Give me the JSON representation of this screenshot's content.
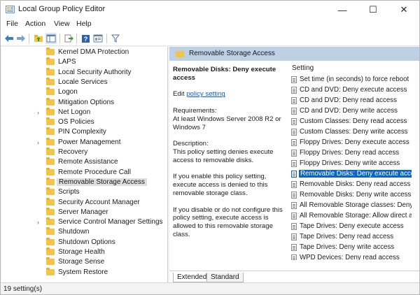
{
  "window": {
    "title": "Local Group Policy Editor",
    "minimize": "—",
    "maximize": "☐",
    "close": "✕"
  },
  "menu": [
    "File",
    "Action",
    "View",
    "Help"
  ],
  "toolbar": {
    "icons": [
      "back-arrow-icon",
      "forward-arrow-icon",
      "up-folder-icon",
      "show-hide-tree-icon",
      "export-list-icon",
      "help-icon",
      "properties-icon",
      "filter-icon"
    ]
  },
  "tree": {
    "items": [
      {
        "label": "Kernel DMA Protection",
        "expandable": false,
        "selected": false
      },
      {
        "label": "LAPS",
        "expandable": false,
        "selected": false
      },
      {
        "label": "Local Security Authority",
        "expandable": false,
        "selected": false
      },
      {
        "label": "Locale Services",
        "expandable": false,
        "selected": false
      },
      {
        "label": "Logon",
        "expandable": false,
        "selected": false
      },
      {
        "label": "Mitigation Options",
        "expandable": false,
        "selected": false
      },
      {
        "label": "Net Logon",
        "expandable": true,
        "selected": false
      },
      {
        "label": "OS Policies",
        "expandable": false,
        "selected": false
      },
      {
        "label": "PIN Complexity",
        "expandable": false,
        "selected": false
      },
      {
        "label": "Power Management",
        "expandable": true,
        "selected": false
      },
      {
        "label": "Recovery",
        "expandable": false,
        "selected": false
      },
      {
        "label": "Remote Assistance",
        "expandable": false,
        "selected": false
      },
      {
        "label": "Remote Procedure Call",
        "expandable": false,
        "selected": false
      },
      {
        "label": "Removable Storage Access",
        "expandable": false,
        "selected": true
      },
      {
        "label": "Scripts",
        "expandable": false,
        "selected": false
      },
      {
        "label": "Security Account Manager",
        "expandable": false,
        "selected": false
      },
      {
        "label": "Server Manager",
        "expandable": false,
        "selected": false
      },
      {
        "label": "Service Control Manager Settings",
        "expandable": true,
        "selected": false
      },
      {
        "label": "Shutdown",
        "expandable": false,
        "selected": false
      },
      {
        "label": "Shutdown Options",
        "expandable": false,
        "selected": false
      },
      {
        "label": "Storage Health",
        "expandable": false,
        "selected": false
      },
      {
        "label": "Storage Sense",
        "expandable": false,
        "selected": false
      },
      {
        "label": "System Restore",
        "expandable": false,
        "selected": false
      }
    ]
  },
  "details": {
    "header": "Removable Storage Access",
    "policy_title": "Removable Disks: Deny execute access",
    "edit_prefix": "Edit ",
    "edit_link": "policy setting",
    "requirements_label": "Requirements:",
    "requirements_text": "At least Windows Server 2008 R2 or Windows 7",
    "description_label": "Description:",
    "description_text": "This policy setting denies execute access to removable disks.",
    "enable_text": "If you enable this policy setting, execute access is denied to this removable storage class.",
    "disable_text": "If you disable or do not configure this policy setting, execute access is allowed to this removable storage class."
  },
  "settings": {
    "column_header": "Setting",
    "rows": [
      {
        "label": "Set time (in seconds) to force reboot",
        "selected": false
      },
      {
        "label": "CD and DVD: Deny execute access",
        "selected": false
      },
      {
        "label": "CD and DVD: Deny read access",
        "selected": false
      },
      {
        "label": "CD and DVD: Deny write access",
        "selected": false
      },
      {
        "label": "Custom Classes: Deny read access",
        "selected": false
      },
      {
        "label": "Custom Classes: Deny write access",
        "selected": false
      },
      {
        "label": "Floppy Drives: Deny execute access",
        "selected": false
      },
      {
        "label": "Floppy Drives: Deny read access",
        "selected": false
      },
      {
        "label": "Floppy Drives: Deny write access",
        "selected": false
      },
      {
        "label": "Removable Disks: Deny execute access",
        "selected": true
      },
      {
        "label": "Removable Disks: Deny read access",
        "selected": false
      },
      {
        "label": "Removable Disks: Deny write access",
        "selected": false
      },
      {
        "label": "All Removable Storage classes: Deny all access",
        "selected": false
      },
      {
        "label": "All Removable Storage: Allow direct access in remote sessions",
        "selected": false
      },
      {
        "label": "Tape Drives: Deny execute access",
        "selected": false
      },
      {
        "label": "Tape Drives: Deny read access",
        "selected": false
      },
      {
        "label": "Tape Drives: Deny write access",
        "selected": false
      },
      {
        "label": "WPD Devices: Deny read access",
        "selected": false
      }
    ]
  },
  "tabs": [
    "Extended",
    "Standard"
  ],
  "status": "19 setting(s)"
}
